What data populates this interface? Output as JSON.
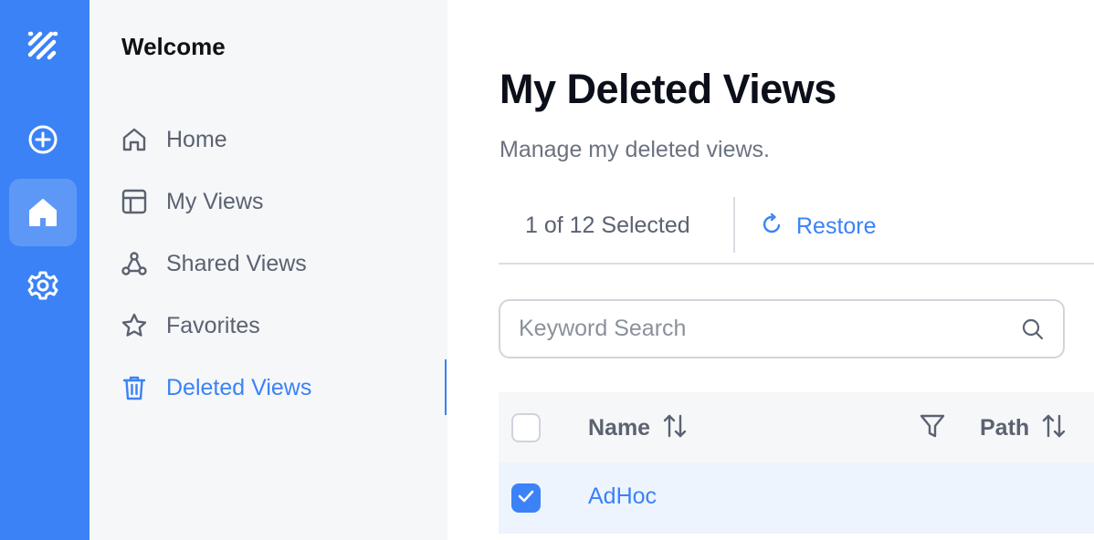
{
  "sidebar": {
    "heading": "Welcome",
    "items": [
      {
        "label": "Home",
        "icon": "home-outline-icon"
      },
      {
        "label": "My Views",
        "icon": "layout-icon"
      },
      {
        "label": "Shared Views",
        "icon": "share-network-icon"
      },
      {
        "label": "Favorites",
        "icon": "star-icon"
      },
      {
        "label": "Deleted Views",
        "icon": "trash-icon",
        "active": true
      }
    ]
  },
  "rail": {
    "items": [
      "logo-icon",
      "add-circle-icon",
      "home-icon",
      "gear-icon"
    ],
    "active": "home-icon"
  },
  "main": {
    "title": "My Deleted Views",
    "subtitle": "Manage my deleted views.",
    "toolbar": {
      "selection_text": "1 of 12 Selected",
      "restore_label": "Restore",
      "restore_icon": "refresh-icon"
    },
    "search": {
      "placeholder": "Keyword Search",
      "value": ""
    },
    "table": {
      "columns": [
        {
          "label": "Name",
          "sortable": true,
          "filterable": true
        },
        {
          "label": "Path",
          "sortable": true
        }
      ],
      "rows": [
        {
          "name": "AdHoc",
          "selected": true
        }
      ]
    }
  },
  "colors": {
    "accent": "#3b82f6",
    "sidebar_bg": "#f6f7f9",
    "selected_row_bg": "#edf4fe",
    "muted_text": "#5b6270"
  }
}
